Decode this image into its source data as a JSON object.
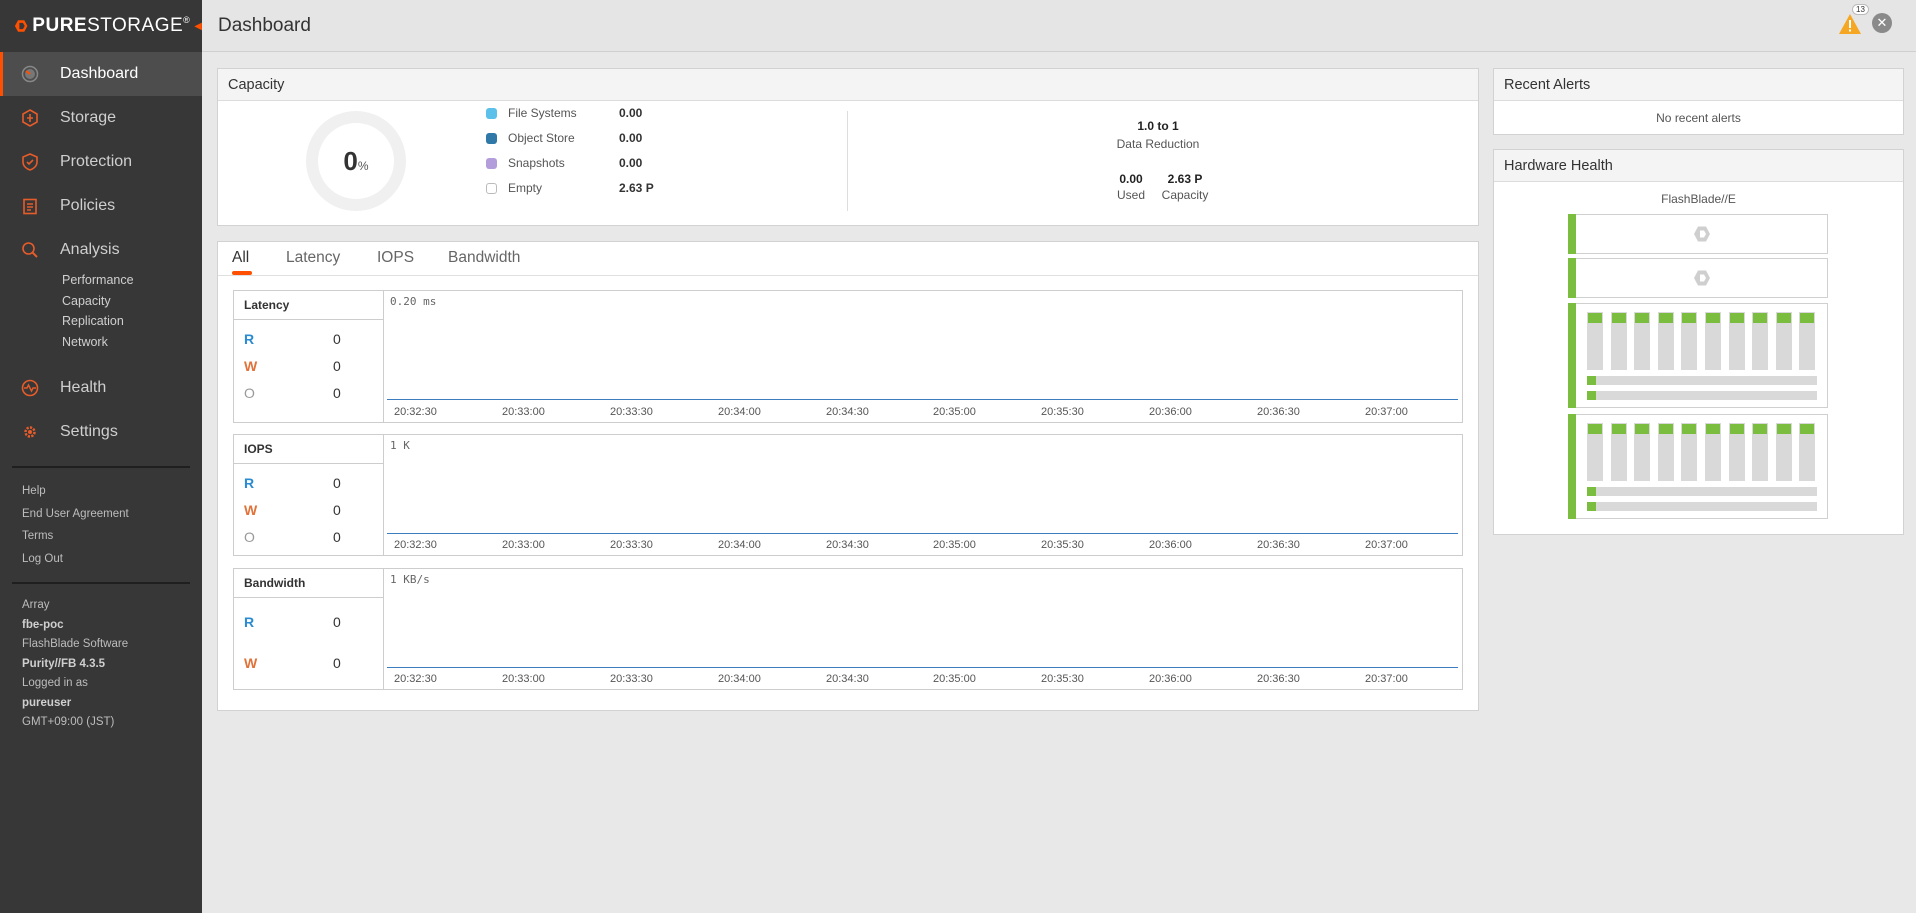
{
  "brand": {
    "name_bold": "PURE",
    "name_thin": "STORAGE",
    "reg": "®"
  },
  "colors": {
    "accent": "#fe5000",
    "sidebar": "#373737",
    "read": "#2a8bd0",
    "write": "#e0723a",
    "healthy": "#7bbd3f"
  },
  "header": {
    "title": "Dashboard",
    "alert_count": "13"
  },
  "sidebar": {
    "nav": [
      {
        "label": "Dashboard",
        "icon": "dashboard-icon"
      },
      {
        "label": "Storage",
        "icon": "storage-icon"
      },
      {
        "label": "Protection",
        "icon": "shield-icon"
      },
      {
        "label": "Policies",
        "icon": "clipboard-icon"
      },
      {
        "label": "Analysis",
        "icon": "analysis-icon"
      },
      {
        "label": "Health",
        "icon": "health-icon"
      },
      {
        "label": "Settings",
        "icon": "gear-icon"
      }
    ],
    "analysis_sub": [
      "Performance",
      "Capacity",
      "Replication",
      "Network"
    ],
    "links": [
      "Help",
      "End User Agreement",
      "Terms",
      "Log Out"
    ],
    "info": {
      "array_label": "Array",
      "array_name": "fbe-poc",
      "software_label": "FlashBlade Software",
      "software_version": "Purity//FB 4.3.5",
      "logged_label": "Logged in as",
      "user": "pureuser",
      "timezone": "GMT+09:00 (JST)"
    }
  },
  "capacity": {
    "title": "Capacity",
    "percent": "0",
    "percent_sign": "%",
    "legend": [
      {
        "label": "File Systems",
        "value": "0.00",
        "color": "#5bc0ea"
      },
      {
        "label": "Object Store",
        "value": "0.00",
        "color": "#2f78a8"
      },
      {
        "label": "Snapshots",
        "value": "0.00",
        "color": "#b39ddb"
      },
      {
        "label": "Empty",
        "value": "2.63 P",
        "color": "#ffffff"
      }
    ],
    "reduction_value": "1.0 to 1",
    "reduction_label": "Data Reduction",
    "used_value": "0.00",
    "used_label": "Used",
    "capacity_value": "2.63 P",
    "capacity_label": "Capacity"
  },
  "tabs": [
    "All",
    "Latency",
    "IOPS",
    "Bandwidth"
  ],
  "charts": [
    {
      "title": "Latency",
      "ymax": "0.20 ms",
      "metrics": [
        {
          "key": "R",
          "value": "0"
        },
        {
          "key": "W",
          "value": "0"
        },
        {
          "key": "O",
          "value": "0"
        }
      ]
    },
    {
      "title": "IOPS",
      "ymax": "1 K",
      "metrics": [
        {
          "key": "R",
          "value": "0"
        },
        {
          "key": "W",
          "value": "0"
        },
        {
          "key": "O",
          "value": "0"
        }
      ]
    },
    {
      "title": "Bandwidth",
      "ymax": "1 KB/s",
      "metrics": [
        {
          "key": "R",
          "value": "0"
        },
        {
          "key": "W",
          "value": "0"
        }
      ]
    }
  ],
  "x_ticks": [
    "20:32:30",
    "20:33:00",
    "20:33:30",
    "20:34:00",
    "20:34:30",
    "20:35:00",
    "20:35:30",
    "20:36:00",
    "20:36:30",
    "20:37:00"
  ],
  "alerts": {
    "title": "Recent Alerts",
    "message": "No recent alerts"
  },
  "hardware": {
    "title": "Hardware Health",
    "model": "FlashBlade//E"
  }
}
